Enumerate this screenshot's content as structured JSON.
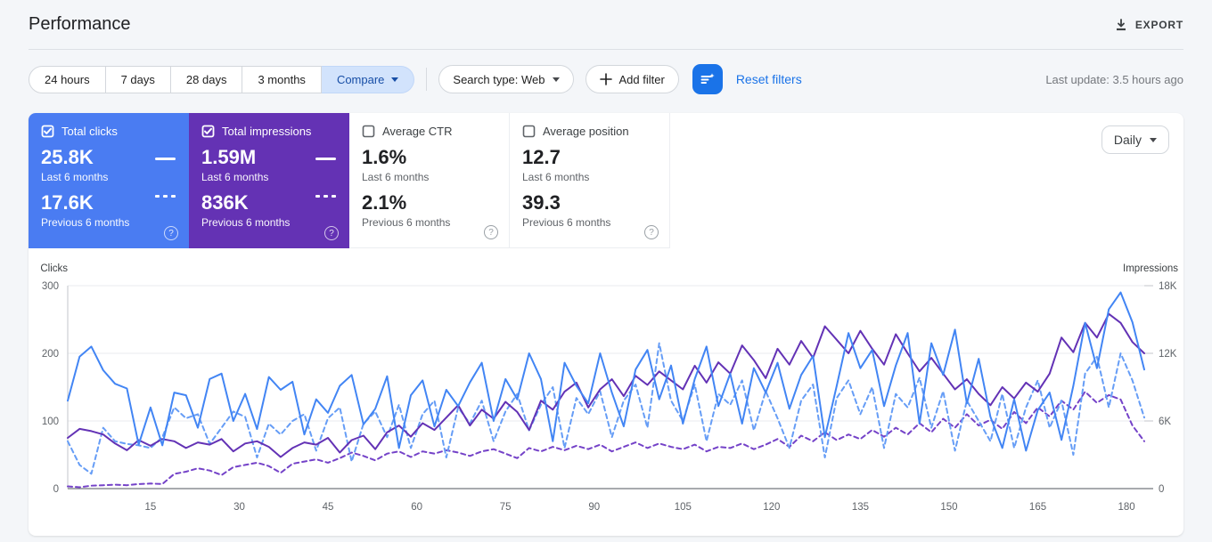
{
  "header": {
    "title": "Performance",
    "export_label": "EXPORT"
  },
  "filters": {
    "ranges": [
      "24 hours",
      "7 days",
      "28 days",
      "3 months"
    ],
    "compare_label": "Compare",
    "search_type_label": "Search type: Web",
    "add_filter_label": "Add filter",
    "reset_label": "Reset filters",
    "last_update": "Last update: 3.5 hours ago"
  },
  "granularity": {
    "selected": "Daily"
  },
  "icons": {
    "export": "download-icon",
    "filter_button": "filter-sparkle-icon",
    "help_glyph": "?"
  },
  "cards": [
    {
      "label": "Total clicks",
      "checked": true,
      "color": "#4a7cf2",
      "current": "25.8K",
      "current_caption": "Last 6 months",
      "previous": "17.6K",
      "previous_caption": "Previous 6 months"
    },
    {
      "label": "Total impressions",
      "checked": true,
      "color": "#6432b4",
      "current": "1.59M",
      "current_caption": "Last 6 months",
      "previous": "836K",
      "previous_caption": "Previous 6 months"
    },
    {
      "label": "Average CTR",
      "checked": false,
      "color": null,
      "current": "1.6%",
      "current_caption": "Last 6 months",
      "previous": "2.1%",
      "previous_caption": "Previous 6 months"
    },
    {
      "label": "Average position",
      "checked": false,
      "color": null,
      "current": "12.7",
      "current_caption": "Last 6 months",
      "previous": "39.3",
      "previous_caption": "Previous 6 months"
    }
  ],
  "chart_data": {
    "type": "line",
    "x_range": [
      1,
      183
    ],
    "x_tick_labels": [
      15,
      30,
      45,
      60,
      75,
      90,
      105,
      120,
      135,
      150,
      165,
      180
    ],
    "grid": "horizontal",
    "legend": "none",
    "left_axis": {
      "title": "Clicks",
      "max": 300,
      "ticks": [
        {
          "value": 0,
          "label": "0"
        },
        {
          "value": 100,
          "label": "100"
        },
        {
          "value": 200,
          "label": "200"
        },
        {
          "value": 300,
          "label": "300"
        }
      ]
    },
    "right_axis": {
      "title": "Impressions",
      "max": 18000,
      "ticks": [
        {
          "value": 0,
          "label": "0"
        },
        {
          "value": 6000,
          "label": "6K"
        },
        {
          "value": 12000,
          "label": "12K"
        },
        {
          "value": 18000,
          "label": "18K"
        }
      ]
    },
    "series": [
      {
        "id": "impressions-previous",
        "name": "Total impressions — Previous 6 months",
        "axis": "right",
        "style": "dashed",
        "color": "#7442c8",
        "values": [
          200,
          120,
          260,
          300,
          350,
          300,
          400,
          450,
          400,
          1300,
          1500,
          1800,
          1600,
          1200,
          1900,
          2100,
          2300,
          2000,
          1400,
          2200,
          2400,
          2600,
          2300,
          2700,
          3200,
          2900,
          2500,
          3100,
          3300,
          2800,
          3300,
          3100,
          3400,
          3200,
          2900,
          3300,
          3500,
          3100,
          2700,
          3600,
          3300,
          3700,
          3400,
          3800,
          3500,
          3900,
          3300,
          3700,
          4100,
          3600,
          4000,
          3700,
          3500,
          3900,
          3300,
          3700,
          3600,
          4000,
          3500,
          3900,
          4400,
          3700,
          4700,
          4200,
          5000,
          4300,
          4800,
          4400,
          5200,
          4600,
          5400,
          4800,
          5800,
          5000,
          6200,
          5400,
          6600,
          5600,
          6100,
          5300,
          6800,
          5800,
          7200,
          6400,
          7800,
          7000,
          8600,
          7600,
          8300,
          7900,
          5600,
          4200
        ]
      },
      {
        "id": "clicks-previous",
        "name": "Total clicks — Previous 6 months",
        "axis": "left",
        "style": "dashed",
        "color": "#669df6",
        "values": [
          70,
          35,
          22,
          90,
          70,
          66,
          64,
          60,
          76,
          120,
          104,
          110,
          66,
          90,
          114,
          106,
          46,
          96,
          80,
          100,
          110,
          56,
          104,
          120,
          40,
          96,
          114,
          76,
          124,
          60,
          110,
          130,
          46,
          120,
          96,
          130,
          70,
          114,
          140,
          86,
          124,
          150,
          60,
          134,
          110,
          144,
          76,
          130,
          154,
          90,
          215,
          130,
          100,
          154,
          70,
          140,
          124,
          160,
          86,
          144,
          104,
          60,
          130,
          154,
          46,
          134,
          160,
          110,
          150,
          60,
          140,
          120,
          164,
          90,
          144,
          56,
          130,
          100,
          70,
          140,
          60,
          120,
          160,
          90,
          130,
          50,
          170,
          195,
          120,
          200,
          160,
          105
        ]
      },
      {
        "id": "impressions-current",
        "name": "Total impressions — Last 6 months",
        "axis": "right",
        "style": "solid",
        "color": "#6332b5",
        "values": [
          4500,
          5300,
          5100,
          4800,
          4000,
          3400,
          4300,
          3800,
          4400,
          4200,
          3600,
          4100,
          3900,
          4400,
          3300,
          4000,
          4200,
          3700,
          2800,
          3600,
          4100,
          3900,
          4500,
          3200,
          4300,
          4700,
          3500,
          5000,
          5600,
          4600,
          5800,
          5200,
          6300,
          7400,
          5600,
          7000,
          6200,
          7700,
          6800,
          5200,
          7800,
          7000,
          8600,
          9400,
          7200,
          8800,
          9700,
          8200,
          10000,
          9200,
          10400,
          9600,
          8800,
          10900,
          9400,
          11200,
          10200,
          12700,
          11400,
          9800,
          12400,
          11000,
          13100,
          11600,
          14400,
          13200,
          12000,
          14000,
          12400,
          11000,
          13700,
          12000,
          10400,
          11600,
          10200,
          8800,
          9700,
          8400,
          7400,
          9000,
          8000,
          9400,
          8600,
          10200,
          13400,
          12100,
          14700,
          13400,
          15500,
          14700,
          13000,
          12000
        ]
      },
      {
        "id": "clicks-current",
        "name": "Total clicks — Last 6 months",
        "axis": "left",
        "style": "solid",
        "color": "#4285f4",
        "values": [
          130,
          195,
          210,
          175,
          155,
          148,
          65,
          120,
          64,
          142,
          138,
          90,
          162,
          170,
          100,
          140,
          88,
          165,
          146,
          158,
          80,
          132,
          112,
          152,
          168,
          95,
          118,
          166,
          60,
          138,
          160,
          92,
          146,
          122,
          157,
          186,
          100,
          162,
          132,
          200,
          162,
          70,
          186,
          152,
          126,
          200,
          142,
          92,
          176,
          205,
          132,
          182,
          96,
          162,
          210,
          122,
          170,
          96,
          178,
          142,
          186,
          118,
          168,
          196,
          76,
          152,
          230,
          178,
          205,
          122,
          182,
          230,
          96,
          215,
          168,
          235,
          126,
          192,
          106,
          60,
          132,
          56,
          116,
          142,
          72,
          152,
          245,
          178,
          265,
          290,
          246,
          176
        ]
      }
    ]
  }
}
